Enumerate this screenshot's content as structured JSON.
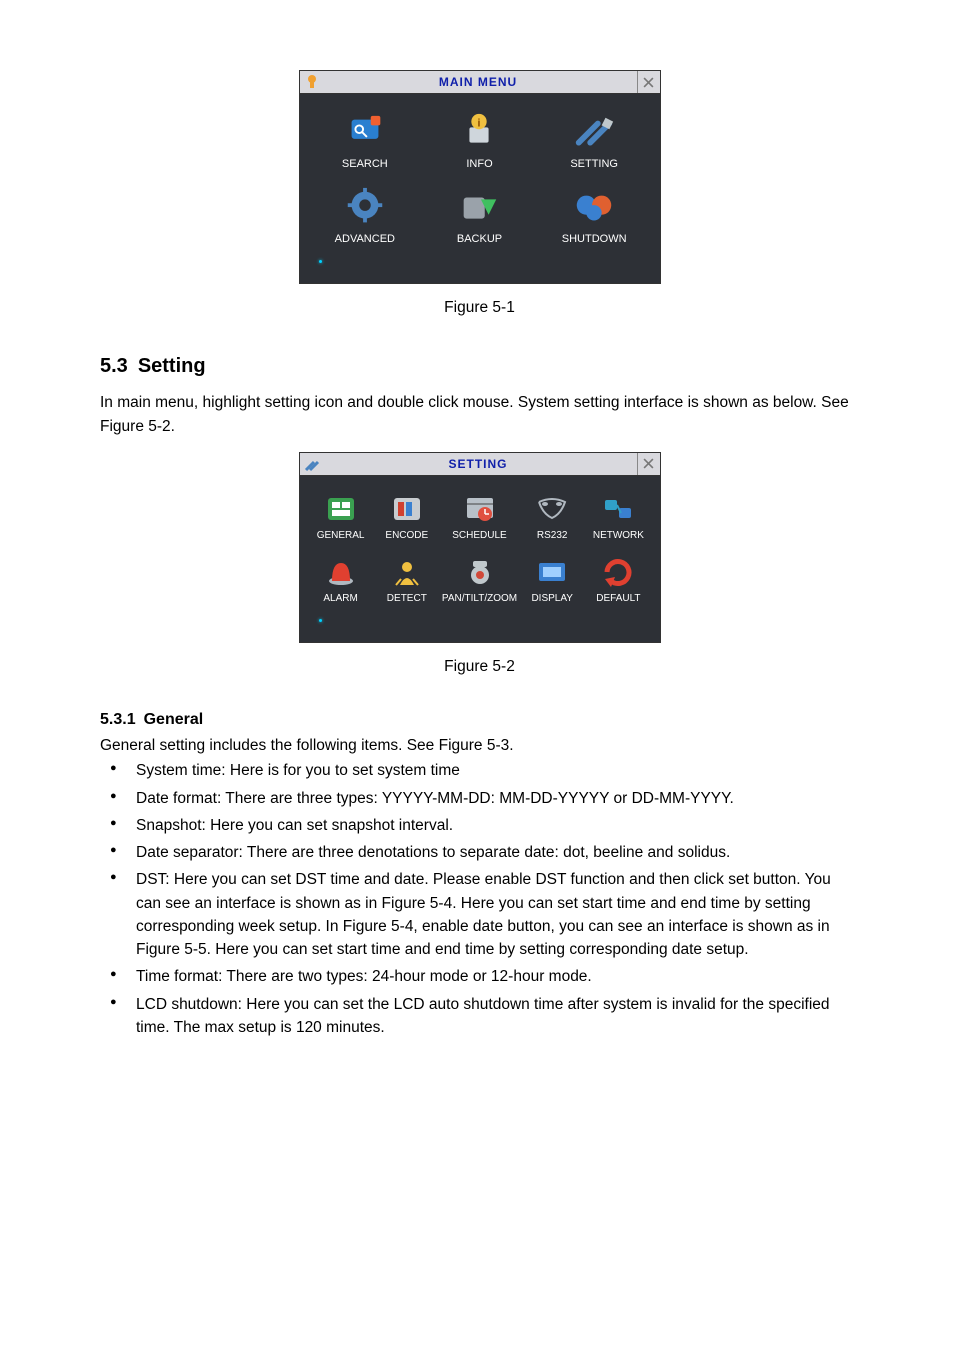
{
  "fig1": {
    "title": "MAIN MENU",
    "items": [
      {
        "label": "SEARCH",
        "icon": "search-icon"
      },
      {
        "label": "INFO",
        "icon": "info-icon"
      },
      {
        "label": "SETTING",
        "icon": "setting-icon"
      },
      {
        "label": "ADVANCED",
        "icon": "advanced-icon"
      },
      {
        "label": "BACKUP",
        "icon": "backup-icon"
      },
      {
        "label": "SHUTDOWN",
        "icon": "shutdown-icon"
      }
    ],
    "caption": "Figure 5-1"
  },
  "section53": {
    "number": "5.3",
    "title": "Setting",
    "intro": "In main menu, highlight setting icon and double click mouse. System setting interface is shown as below. See Figure 5-2."
  },
  "fig2": {
    "title": "SETTING",
    "items": [
      {
        "label": "GENERAL",
        "icon": "general-icon"
      },
      {
        "label": "ENCODE",
        "icon": "encode-icon"
      },
      {
        "label": "SCHEDULE",
        "icon": "schedule-icon"
      },
      {
        "label": "RS232",
        "icon": "rs232-icon"
      },
      {
        "label": "NETWORK",
        "icon": "network-icon"
      },
      {
        "label": "ALARM",
        "icon": "alarm-icon"
      },
      {
        "label": "DETECT",
        "icon": "detect-icon"
      },
      {
        "label": "PAN/TILT/ZOOM",
        "icon": "ptz-icon"
      },
      {
        "label": "DISPLAY",
        "icon": "display-icon"
      },
      {
        "label": "DEFAULT",
        "icon": "default-icon"
      }
    ],
    "caption": "Figure 5-2"
  },
  "section531": {
    "number": "5.3.1",
    "title": "General",
    "intro": "General setting includes the following items. See Figure 5-3.",
    "bullets": [
      "System time: Here is for you to set system time",
      "Date format: There are three types: YYYYY-MM-DD: MM-DD-YYYYY or DD-MM-YYYY.",
      "Snapshot: Here you can set snapshot interval.",
      "Date separator: There are three denotations to separate date: dot, beeline and solidus.",
      "DST: Here you can set DST time and date. Please enable DST function and then click set button. You can see an interface is shown as in Figure 5-4. Here you can set start time and end time by setting corresponding week setup. In Figure 5-4, enable date button, you can see an interface is shown as in Figure 5-5. Here you can set start time and end time by setting corresponding date setup.",
      "Time format: There are two types: 24-hour mode or 12-hour mode.",
      "LCD shutdown: Here you can set the LCD auto shutdown time after system is invalid for the specified time. The max setup is 120 minutes."
    ]
  }
}
